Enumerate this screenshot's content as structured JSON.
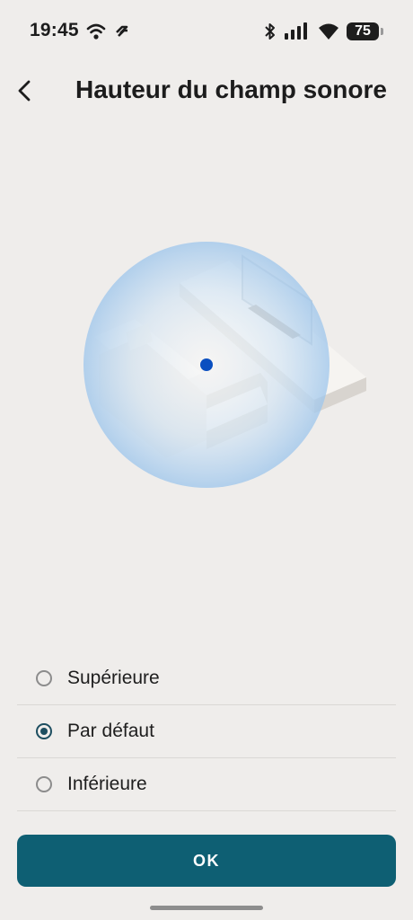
{
  "status_bar": {
    "time": "19:45",
    "battery": "75",
    "icons": [
      "wifi-icon",
      "nfc-icon",
      "bluetooth-icon",
      "signal-icon",
      "wifi-icon",
      "battery-icon"
    ]
  },
  "header": {
    "back_icon": "chevron-left-icon",
    "title": "Hauteur du champ sonore"
  },
  "illustration": {
    "description_icon": "room-sound-field-illustration",
    "sphere_color": "#b7d6f0",
    "dot_color": "#0a4fc0"
  },
  "options": [
    {
      "label": "Supérieure",
      "selected": false
    },
    {
      "label": "Par défaut",
      "selected": true
    },
    {
      "label": "Inférieure",
      "selected": false
    }
  ],
  "ok_button": {
    "label": "OK"
  },
  "colors": {
    "background": "#efedeb",
    "accent": "#0e5f73",
    "radio_selected": "#1d4e60"
  }
}
